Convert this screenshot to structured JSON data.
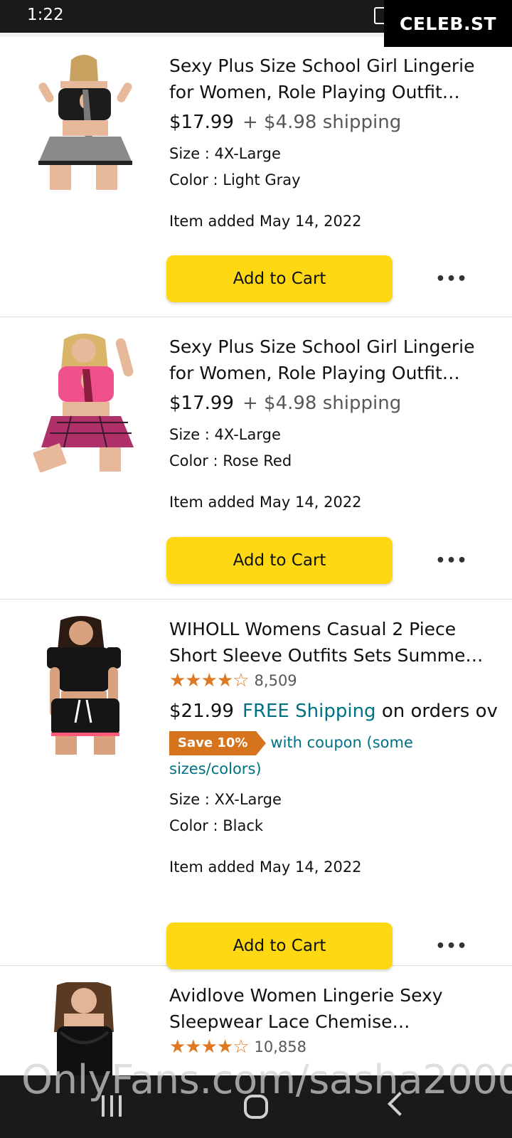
{
  "status_bar": {
    "time": "1:22"
  },
  "watermark": {
    "top": "CELEB.ST",
    "bottom": "OnlyFans.com/sasha2000"
  },
  "items": [
    {
      "title": "Sexy Plus Size School Girl Lingerie for Women, Role Playing Outfit…",
      "price": "$17.99",
      "shipping": "+ $4.98 shipping",
      "size": "Size : 4X-Large",
      "color": "Color : Light Gray",
      "added": "Item added May 14, 2022",
      "cart_label": "Add to Cart",
      "more_label": "•••",
      "image_colors": {
        "top": "#1c1c1c",
        "skirt": "#8a8a8a",
        "skin": "#e8b89a",
        "tie": "#7a7a7a"
      }
    },
    {
      "title": "Sexy Plus Size School Girl Lingerie for Women, Role Playing Outfit…",
      "price": "$17.99",
      "shipping": "+ $4.98 shipping",
      "size": "Size : 4X-Large",
      "color": "Color : Rose Red",
      "added": "Item added May 14, 2022",
      "cart_label": "Add to Cart",
      "more_label": "•••",
      "image_colors": {
        "top": "#f0508c",
        "skirt": "#b0306a",
        "skin": "#e8b89a",
        "tie": "#8a1e3c"
      }
    },
    {
      "title": "WIHOLL Womens Casual 2 Piece Short Sleeve Outfits Sets Summe…",
      "rating_stars": "★★★★",
      "rating_last_star": "☆",
      "rating_count": "8,509",
      "price": "$21.99",
      "free_shipping": "FREE Shipping",
      "shipping_rest": "on orders ov",
      "coupon_badge": "Save 10%",
      "coupon_text": "with coupon (some sizes/colors)",
      "size": "Size : XX-Large",
      "color": "Color : Black",
      "added": "Item added May 14, 2022",
      "cart_label": "Add to Cart",
      "more_label": "•••",
      "image_colors": {
        "top": "#151515",
        "skirt": "#151515",
        "skin": "#d9a27e",
        "tie": "#ff5a7a"
      }
    },
    {
      "title": "Avidlove Women Lingerie Sexy Sleepwear Lace Chemise…",
      "rating_stars": "★★★★",
      "rating_last_star": "☆",
      "rating_count": "10,858",
      "image_colors": {
        "top": "#101010",
        "skirt": "#101010",
        "skin": "#e3b497",
        "tie": "#2a2a2a"
      }
    }
  ],
  "accent": {
    "button": "#ffd814",
    "link": "#007185",
    "star": "#de7921",
    "coupon": "#d5741d"
  }
}
